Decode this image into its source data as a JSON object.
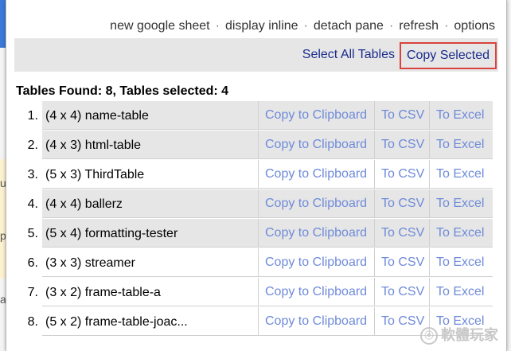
{
  "pane_links": [
    "new google sheet",
    "display inline",
    "detach pane",
    "refresh",
    "options"
  ],
  "link_separator": "·",
  "toolbar": {
    "select_all_label": "Select All Tables",
    "copy_selected_label": "Copy Selected"
  },
  "summary": "Tables Found: 8, Tables selected: 4",
  "actions": {
    "clipboard": "Copy to Clipboard",
    "csv": "To CSV",
    "excel": "To Excel"
  },
  "tables": [
    {
      "num": "1.",
      "name": "(4 x 4) name-table",
      "selected": true
    },
    {
      "num": "2.",
      "name": "(4 x 3) html-table",
      "selected": true
    },
    {
      "num": "3.",
      "name": "(5 x 3) ThirdTable",
      "selected": false
    },
    {
      "num": "4.",
      "name": "(4 x 4) ballerz",
      "selected": true
    },
    {
      "num": "5.",
      "name": "(5 x 4) formatting-tester",
      "selected": true
    },
    {
      "num": "6.",
      "name": "(3 x 3) streamer",
      "selected": false
    },
    {
      "num": "7.",
      "name": "(3 x 2) frame-table-a",
      "selected": false
    },
    {
      "num": "8.",
      "name": "(5 x 2) frame-table-joac...",
      "selected": false
    }
  ],
  "background_glyphs": [
    "u",
    "p",
    "a"
  ],
  "watermark": {
    "mark": "ⓔ",
    "text": "軟體玩家"
  },
  "colors": {
    "link": "#6f8bd9",
    "button_text": "#1a2c8c",
    "highlight_border": "#d9433d",
    "selected_row": "#e6e6e6"
  }
}
